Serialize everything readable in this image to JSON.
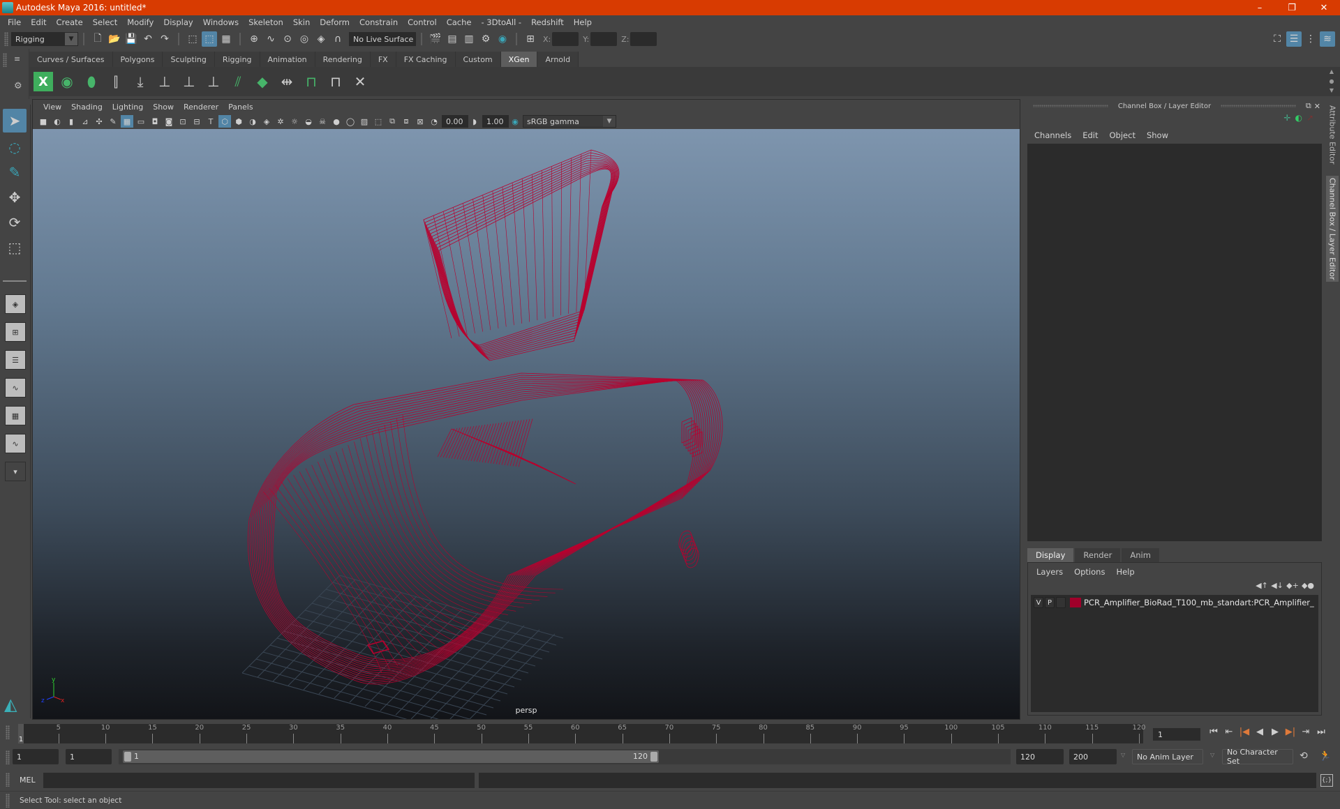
{
  "window": {
    "title": "Autodesk Maya 2016: untitled*",
    "controls": [
      "–",
      "❐",
      "✕"
    ]
  },
  "menubar": {
    "items": [
      "File",
      "Edit",
      "Create",
      "Select",
      "Modify",
      "Display",
      "Windows",
      "Skeleton",
      "Skin",
      "Deform",
      "Constrain",
      "Control",
      "Cache",
      "- 3DtoAll -",
      "Redshift",
      "Help"
    ]
  },
  "statusline": {
    "menuset": "Rigging",
    "live_surface": "No Live Surface",
    "coord_labels": {
      "x": "X:",
      "y": "Y:",
      "z": "Z:"
    },
    "coord_values": {
      "x": "",
      "y": "",
      "z": ""
    }
  },
  "shelf": {
    "tabs": [
      "Curves / Surfaces",
      "Polygons",
      "Sculpting",
      "Rigging",
      "Animation",
      "Rendering",
      "FX",
      "FX Caching",
      "Custom",
      "XGen",
      "Arnold"
    ],
    "active_tab": "XGen",
    "icons": [
      "xgen-window-icon",
      "preview-icon",
      "clear-preview-icon",
      "add-guides-icon",
      "place-guides-icon",
      "add-guide-icon",
      "sculpt-guide-icon",
      "lock-guide-icon",
      "bend-guides-icon",
      "paint-density-icon",
      "guide-length-icon",
      "select-guides-icon",
      "toggle-guides-icon",
      "delete-guides-icon"
    ]
  },
  "viewport": {
    "menu": [
      "View",
      "Shading",
      "Lighting",
      "Show",
      "Renderer",
      "Panels"
    ],
    "exposure": "0.00",
    "gamma": "1.00",
    "color_space": "sRGB gamma",
    "camera_label": "persp",
    "axis": {
      "x": "x",
      "y": "y",
      "z": "z"
    },
    "wire_color": "#b8002e"
  },
  "channelbox": {
    "title": "Channel Box / Layer Editor",
    "menu": [
      "Channels",
      "Edit",
      "Object",
      "Show"
    ],
    "layer_tabs": [
      "Display",
      "Render",
      "Anim"
    ],
    "active_layer_tab": "Display",
    "layer_menu": [
      "Layers",
      "Options",
      "Help"
    ],
    "layers": [
      {
        "v": "V",
        "p": "P",
        "color": "#a0002a",
        "name": "PCR_Amplifier_BioRad_T100_mb_standart:PCR_Amplifier_"
      }
    ]
  },
  "side_tabs": [
    "Attribute Editor",
    "Channel Box / Layer Editor"
  ],
  "timeline": {
    "ticks": [
      5,
      10,
      15,
      20,
      25,
      30,
      35,
      40,
      45,
      50,
      55,
      60,
      65,
      70,
      75,
      80,
      85,
      90,
      95,
      100,
      105,
      110,
      115,
      120
    ],
    "start": 1,
    "end": 120,
    "current_frame_marker": "1",
    "current_frame": "1",
    "playback_buttons": [
      "⏮",
      "⇤",
      "|◀",
      "◀",
      "▶",
      "▶|",
      "⇥",
      "⏭"
    ]
  },
  "range": {
    "start_time": "1",
    "playback_start": "1",
    "slider_start": "1",
    "slider_end": "120",
    "playback_end": "120",
    "end_time": "200",
    "anim_layer": "No Anim Layer",
    "character_set": "No Character Set"
  },
  "cmdline": {
    "label": "MEL",
    "value": ""
  },
  "helpline": {
    "message": "Select Tool: select an object"
  }
}
